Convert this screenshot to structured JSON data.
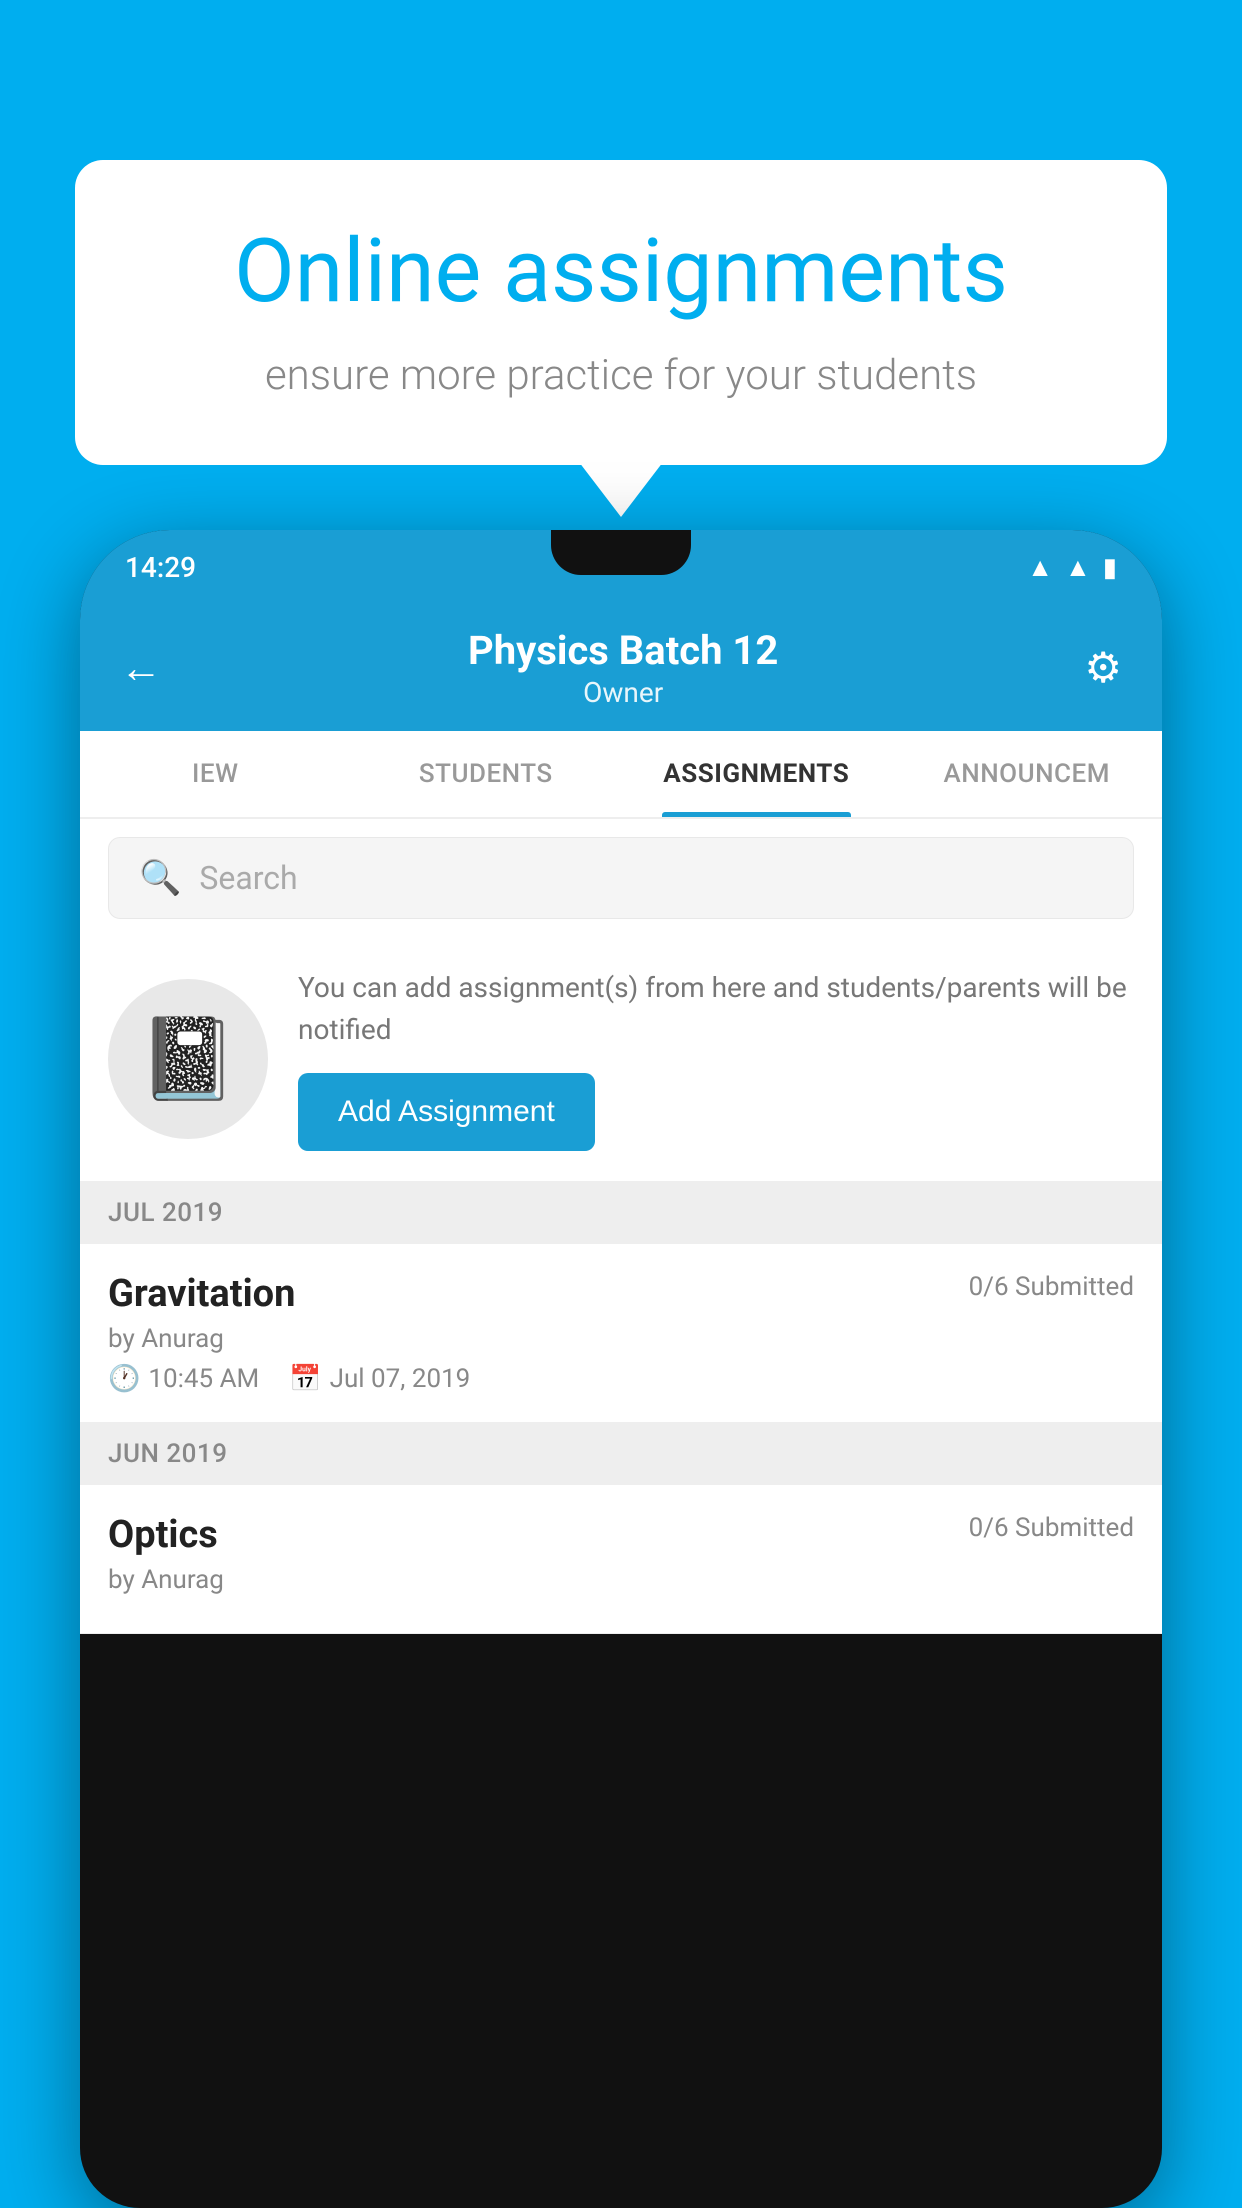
{
  "background_color": "#00AEEF",
  "speech_bubble": {
    "title": "Online assignments",
    "subtitle": "ensure more practice for your students"
  },
  "status_bar": {
    "time": "14:29",
    "icons": [
      "wifi",
      "signal",
      "battery"
    ]
  },
  "app_header": {
    "title": "Physics Batch 12",
    "subtitle": "Owner",
    "back_label": "←",
    "gear_label": "⚙"
  },
  "tabs": [
    {
      "label": "IEW",
      "active": false
    },
    {
      "label": "STUDENTS",
      "active": false
    },
    {
      "label": "ASSIGNMENTS",
      "active": true
    },
    {
      "label": "ANNOUNCEM",
      "active": false
    }
  ],
  "search": {
    "placeholder": "Search"
  },
  "add_assignment_banner": {
    "description_text": "You can add assignment(s) from here and students/parents will be notified",
    "button_label": "Add Assignment"
  },
  "sections": [
    {
      "month": "JUL 2019",
      "items": [
        {
          "name": "Gravitation",
          "submitted": "0/6 Submitted",
          "by": "by Anurag",
          "time": "10:45 AM",
          "date": "Jul 07, 2019"
        }
      ]
    },
    {
      "month": "JUN 2019",
      "items": [
        {
          "name": "Optics",
          "submitted": "0/6 Submitted",
          "by": "by Anurag",
          "time": "",
          "date": ""
        }
      ]
    }
  ],
  "icons": {
    "search": "🔍",
    "clock": "🕐",
    "calendar": "📅",
    "notebook": "📓"
  }
}
